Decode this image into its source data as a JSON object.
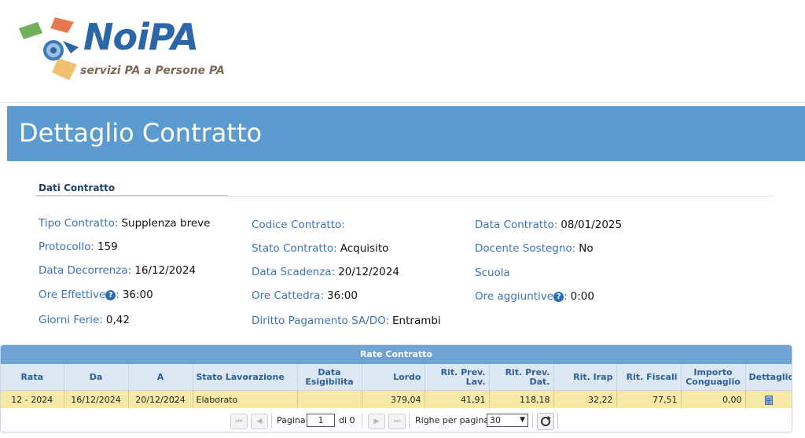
{
  "logo": {
    "brand": "NoiPA",
    "tagline": "servizi PA a Persone PA"
  },
  "page": {
    "title": "Dettaglio Contratto"
  },
  "section": {
    "title": "Dati Contratto"
  },
  "fields": {
    "tipo_contratto": {
      "label": "Tipo Contratto:",
      "value": "Supplenza breve"
    },
    "protocollo": {
      "label": "Protocollo:",
      "value": "159"
    },
    "data_decorrenza": {
      "label": "Data Decorrenza:",
      "value": "16/12/2024"
    },
    "ore_effettive": {
      "label": "Ore Effettive",
      "suffix": ":",
      "value": "36:00"
    },
    "giorni_ferie": {
      "label": "Giorni Ferie:",
      "value": "0,42"
    },
    "codice_contratto": {
      "label": "Codice Contratto:",
      "value": ""
    },
    "stato_contratto": {
      "label": "Stato Contratto:",
      "value": "Acquisito"
    },
    "data_scadenza": {
      "label": "Data Scadenza:",
      "value": "20/12/2024"
    },
    "ore_cattedra": {
      "label": "Ore Cattedra:",
      "value": "36:00"
    },
    "diritto_pagamento": {
      "label": "Diritto Pagamento SA/DO:",
      "value": "Entrambi"
    },
    "data_contratto": {
      "label": "Data Contratto:",
      "value": "08/01/2025"
    },
    "docente_sostegno": {
      "label": "Docente Sostegno:",
      "value": "No"
    },
    "scuola": {
      "label": "Scuola",
      "value": ""
    },
    "ore_aggiuntive": {
      "label": "Ore aggiuntive",
      "suffix": ":",
      "value": "0:00"
    },
    "help_glyph": "?"
  },
  "grid": {
    "caption": "Rate Contratto",
    "columns": [
      "Rata",
      "Da",
      "A",
      "Stato Lavorazione",
      "Data Esigibilita",
      "Lordo",
      "Rit. Prev. Lav.",
      "Rit. Prev. Dat.",
      "Rit. Irap",
      "Rit. Fiscali",
      "Importo Conguaglio",
      "Dettaglio"
    ],
    "rows": [
      [
        "12 - 2024",
        "16/12/2024",
        "20/12/2024",
        "Elaborato",
        "",
        "379,04",
        "41,91",
        "118,18",
        "32,22",
        "77,51",
        "0,00",
        ""
      ]
    ],
    "row_icon": "document-icon",
    "pager": {
      "page_label": "Pagina",
      "page_value": "1",
      "of_label": "di 0",
      "rows_label": "Righe per pagina:",
      "rows_value": "30",
      "first_glyph": "⏮",
      "prev_glyph": "◀",
      "next_glyph": "▶",
      "last_glyph": "⏭"
    }
  },
  "colors": {
    "accent": "#5b9bcf",
    "label": "#3b73b5",
    "row_highlight": "#f6e9a5",
    "header_bg": "#dbe8f4"
  }
}
